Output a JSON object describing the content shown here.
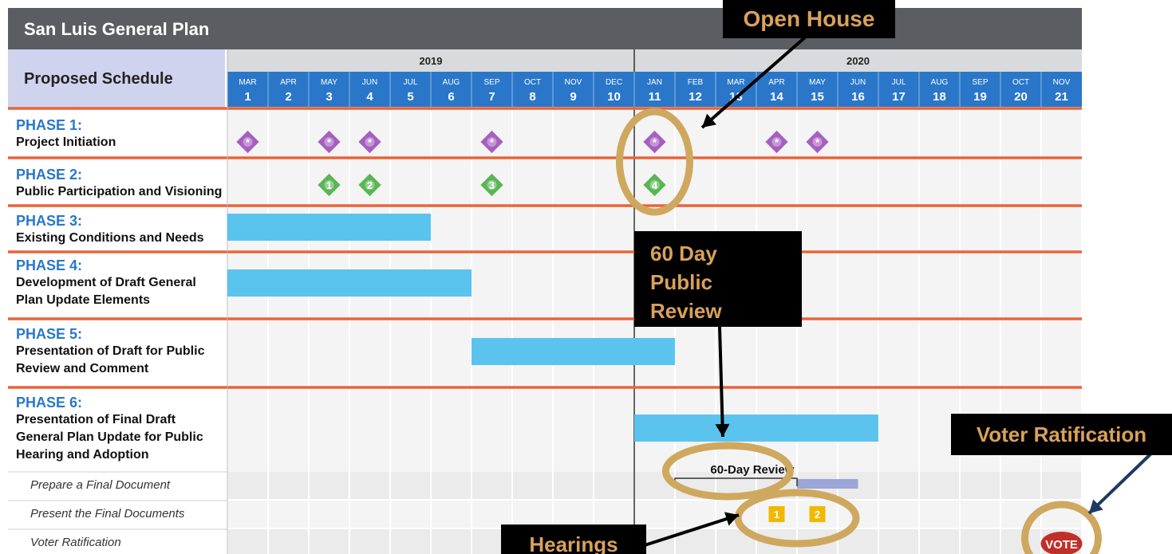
{
  "header": {
    "title": "San Luis General Plan",
    "schedule_label": "Proposed Schedule"
  },
  "timeline": {
    "years": [
      {
        "label": "2019",
        "start": 0,
        "end": 10
      },
      {
        "label": "2020",
        "start": 10,
        "end": 21
      }
    ],
    "months": [
      "MAR",
      "APR",
      "MAY",
      "JUN",
      "JUL",
      "AUG",
      "SEP",
      "OCT",
      "NOV",
      "DEC",
      "JAN",
      "FEB",
      "MAR",
      "APR",
      "MAY",
      "JUN",
      "JUL",
      "AUG",
      "SEP",
      "OCT",
      "NOV"
    ],
    "numbers": [
      "1",
      "2",
      "3",
      "4",
      "5",
      "6",
      "7",
      "8",
      "9",
      "10",
      "11",
      "12",
      "13",
      "14",
      "15",
      "16",
      "17",
      "18",
      "19",
      "20",
      "21"
    ]
  },
  "phases": [
    {
      "ph": "PHASE 1:",
      "name": "Project Initiation"
    },
    {
      "ph": "PHASE 2:",
      "name": "Public Participation and Visioning"
    },
    {
      "ph": "PHASE 3:",
      "name": "Existing Conditions and Needs"
    },
    {
      "ph": "PHASE 4:",
      "name1": "Development of Draft General",
      "name2": "Plan Update Elements"
    },
    {
      "ph": "PHASE 5:",
      "name1": "Presentation of Draft for Public",
      "name2": "Review and Comment"
    },
    {
      "ph": "PHASE 6:",
      "name1": "Presentation of Final Draft",
      "name2": "General Plan Update for Public",
      "name3": "Hearing and Adoption"
    }
  ],
  "subtasks": [
    "Prepare a Final Document",
    "Present the Final Documents",
    "Voter Ratification"
  ],
  "chart_data": {
    "type": "gantt",
    "title": "San Luis General Plan",
    "subtitle": "Proposed Schedule",
    "x_unit": "month number (1 = MAR 2019 ... 21 = NOV 2020)",
    "bars": [
      {
        "task": "Phase 3",
        "start": 1,
        "end": 5,
        "color": "#5bc4ee"
      },
      {
        "task": "Phase 4",
        "start": 1,
        "end": 6,
        "color": "#5bc4ee"
      },
      {
        "task": "Phase 5",
        "start": 7,
        "end": 11,
        "color": "#5bc4ee"
      },
      {
        "task": "Phase 6",
        "start": 11,
        "end": 16,
        "color": "#5bc4ee"
      },
      {
        "task": "Prepare a Final Document",
        "start": 15,
        "end": 16,
        "color": "#9ba6d9"
      }
    ],
    "milestones": [
      {
        "task": "Phase 1",
        "month": 1,
        "kind": "purple",
        "label": "*"
      },
      {
        "task": "Phase 1",
        "month": 3,
        "kind": "purple",
        "label": "*"
      },
      {
        "task": "Phase 1",
        "month": 4,
        "kind": "purple",
        "label": "*"
      },
      {
        "task": "Phase 1",
        "month": 7,
        "kind": "purple",
        "label": "*"
      },
      {
        "task": "Phase 1",
        "month": 11,
        "kind": "purple",
        "label": "*"
      },
      {
        "task": "Phase 1",
        "month": 14,
        "kind": "purple",
        "label": "*"
      },
      {
        "task": "Phase 1",
        "month": 15,
        "kind": "purple",
        "label": "*"
      },
      {
        "task": "Phase 2",
        "month": 3,
        "kind": "green",
        "label": "1"
      },
      {
        "task": "Phase 2",
        "month": 4,
        "kind": "green",
        "label": "2"
      },
      {
        "task": "Phase 2",
        "month": 7,
        "kind": "green",
        "label": "3"
      },
      {
        "task": "Phase 2",
        "month": 11,
        "kind": "green",
        "label": "4"
      },
      {
        "task": "Present the Final Documents",
        "month": 14,
        "kind": "square",
        "label": "1"
      },
      {
        "task": "Present the Final Documents",
        "month": 15,
        "kind": "square",
        "label": "2"
      },
      {
        "task": "Voter Ratification",
        "month": 21,
        "kind": "vote",
        "label": "VOTE"
      }
    ],
    "review_label": "60-Day Review"
  },
  "annotations": {
    "open_house": "Open House",
    "public_review": [
      "60 Day",
      "Public",
      "Review"
    ],
    "voter_ratification": "Voter Ratification",
    "hearings": "Hearings"
  },
  "colors": {
    "header_blue": "#2a77c9",
    "bar_blue": "#5bc4ee",
    "orange_line": "#e8643a",
    "purple": "#a65fc0",
    "green": "#59b653",
    "gold_ring": "#cfa85f",
    "vote_red": "#c0302a",
    "square_gold": "#f0b800"
  }
}
